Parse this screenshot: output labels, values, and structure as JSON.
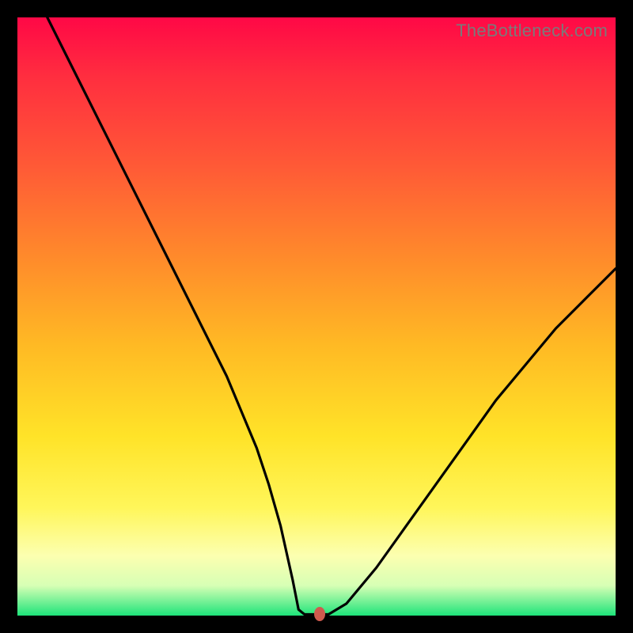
{
  "watermark": "TheBottleneck.com",
  "chart_data": {
    "type": "line",
    "title": "",
    "xlabel": "",
    "ylabel": "",
    "xlim": [
      0,
      100
    ],
    "ylim": [
      0,
      100
    ],
    "grid": false,
    "series": [
      {
        "name": "curve",
        "x": [
          5,
          10,
          15,
          20,
          25,
          30,
          35,
          40,
          42,
          44,
          46,
          47,
          48,
          50,
          52,
          55,
          60,
          65,
          70,
          75,
          80,
          85,
          90,
          95,
          100
        ],
        "y": [
          100,
          90,
          80,
          70,
          60,
          50,
          40,
          28,
          22,
          15,
          6,
          1,
          0.2,
          0.2,
          0.2,
          2,
          8,
          15,
          22,
          29,
          36,
          42,
          48,
          53,
          58
        ]
      }
    ],
    "marker": {
      "x": 50.5,
      "y": 0.2,
      "color": "#cf5a4e"
    },
    "background_gradient": {
      "direction": "vertical",
      "stops": [
        {
          "value": 100,
          "color": "#ff0846"
        },
        {
          "value": 55,
          "color": "#ffba24"
        },
        {
          "value": 10,
          "color": "#fcffb0"
        },
        {
          "value": 0,
          "color": "#1ee47a"
        }
      ]
    },
    "axes_visible": false
  }
}
